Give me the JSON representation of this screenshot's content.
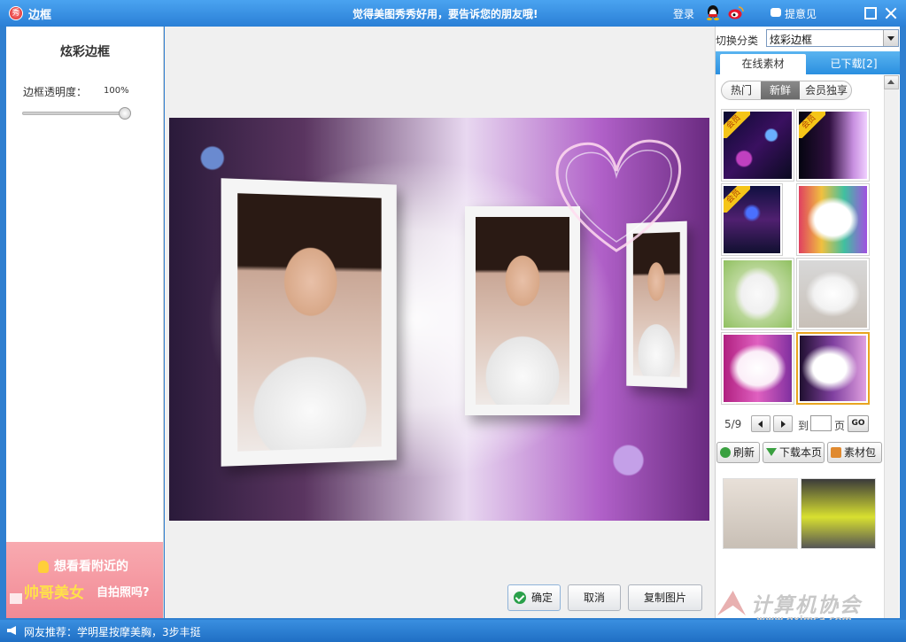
{
  "titlebar": {
    "app_title": "边框",
    "slogan": "觉得美图秀秀好用，要告诉您的朋友哦!",
    "login": "登录",
    "feedback": "提意见"
  },
  "left_panel": {
    "title": "炫彩边框",
    "opacity_label": "边框透明度：",
    "opacity_value": "100%",
    "opacity_level": 1.0
  },
  "ad": {
    "line1": "想看看附近的",
    "line2_highlight": "帅哥美女",
    "line2_tail": "自拍照吗?"
  },
  "main": {
    "buttons": {
      "confirm": "确定",
      "cancel": "取消",
      "copy": "复制图片"
    }
  },
  "right_panel": {
    "category_label": "切换分类",
    "category_value": "炫彩边框",
    "tabs": [
      "在线素材",
      "已下载[2]"
    ],
    "sub_tabs": [
      "热门",
      "新鲜",
      "会员独享"
    ],
    "vip_badge": "会员",
    "pager": {
      "info": "5/9",
      "to": "到",
      "page": "页",
      "go": "GO"
    },
    "actions": {
      "refresh": "刷新",
      "download": "下载本页",
      "pack": "素材包"
    }
  },
  "statusbar": {
    "text": "网友推荐：学明星按摩美胸，3步丰挺"
  },
  "watermark": {
    "cn": "计算机协会",
    "url": "www.gxjmca.com"
  }
}
